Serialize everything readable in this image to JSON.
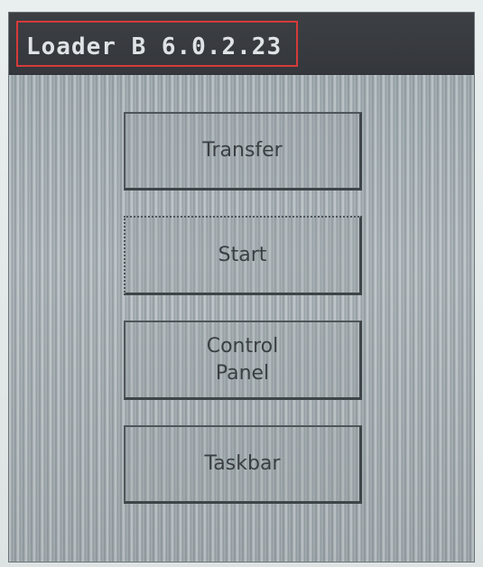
{
  "window": {
    "title": "Loader B 6.0.2.23"
  },
  "buttons": {
    "transfer": "Transfer",
    "start": "Start",
    "control_panel": "Control\nPanel",
    "taskbar": "Taskbar"
  },
  "colors": {
    "title_bar": "#34373b",
    "title_text": "#dfe3e6",
    "highlight_border": "#d63a3a",
    "background": "#a3adb1",
    "button_border": "#3e4548",
    "button_text": "#3a3f43"
  }
}
